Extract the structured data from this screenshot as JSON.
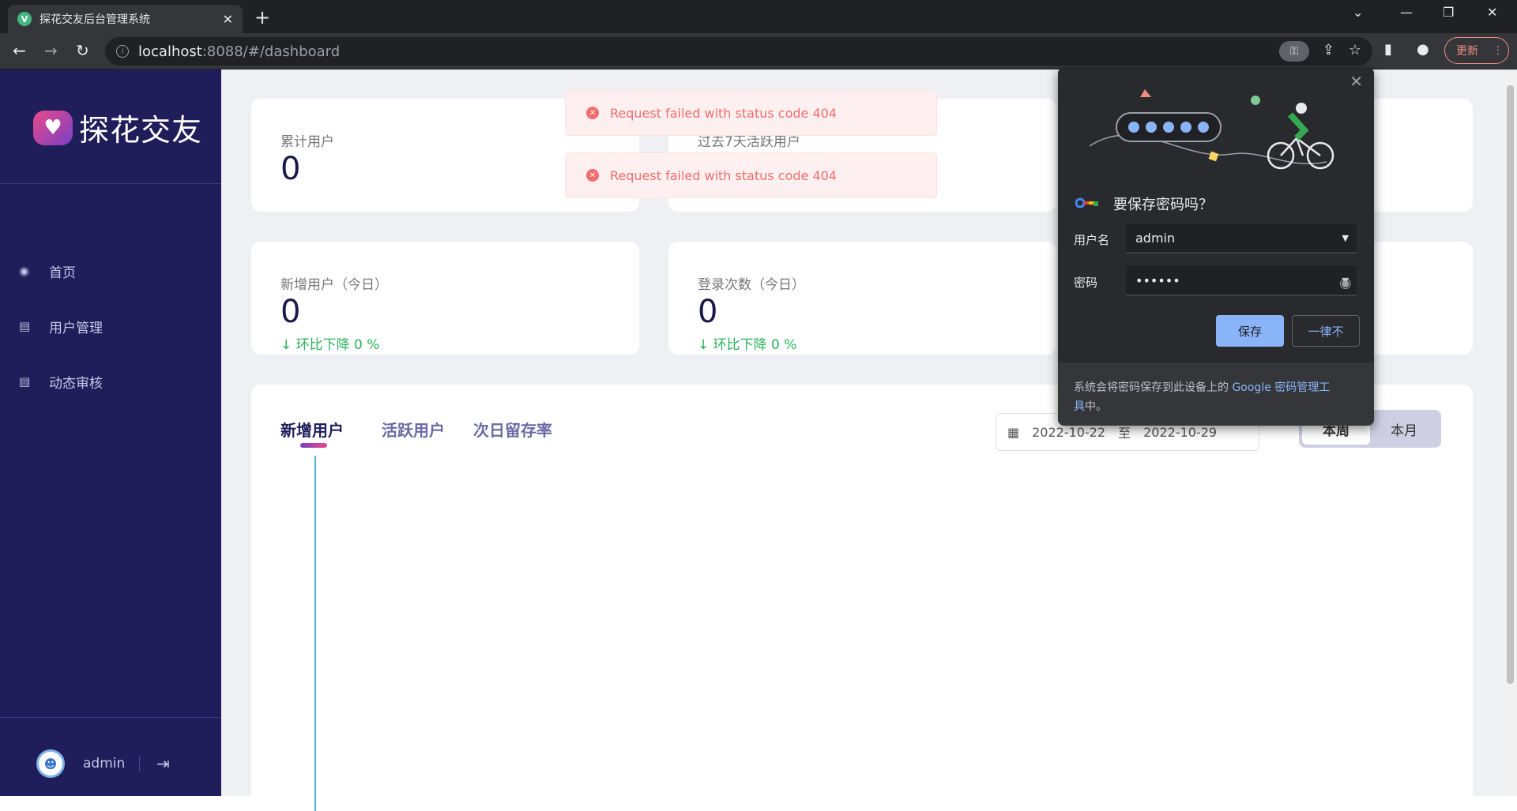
{
  "browser": {
    "tab_title": "探花交友后台管理系统",
    "url_host": "localhost",
    "url_rest": ":8088/#/dashboard",
    "update_label": "更新"
  },
  "sidebar": {
    "logo_text": "探花交友",
    "items": [
      {
        "label": "首页",
        "icon": "dashboard-icon"
      },
      {
        "label": "用户管理",
        "icon": "document-icon"
      },
      {
        "label": "动态审核",
        "icon": "document-icon"
      }
    ],
    "username": "admin"
  },
  "stats": {
    "total_users_label": "累计用户",
    "total_users_value": "0",
    "active_7d_label": "过去7天活跃用户",
    "new_users_label": "新增用户（今日）",
    "new_users_value": "0",
    "new_users_trend": "环比下降 0 %",
    "logins_label": "登录次数（今日）",
    "logins_value": "0",
    "logins_trend": "环比下降 0 %"
  },
  "chart": {
    "tabs": [
      "新增用户",
      "活跃用户",
      "次日留存率"
    ],
    "date_start": "2022-10-22",
    "date_sep": "至",
    "date_end": "2022-10-29",
    "seg_week": "本周",
    "seg_month": "本月"
  },
  "toasts": [
    "Request failed with status code 404",
    "Request failed with status code 404"
  ],
  "password_prompt": {
    "title": "要保存密码吗？",
    "username_label": "用户名",
    "username_value": "admin",
    "password_label": "密码",
    "password_value": "••••••",
    "save_label": "保存",
    "never_label": "一律不",
    "footer_text": "系统会将密码保存到此设备上的 ",
    "footer_link_1": "Google 密码管理工",
    "footer_link_2": "具",
    "footer_end": "中。"
  },
  "colors": {
    "sidebar_bg": "#1f1d5a",
    "trend_green": "#29b25a",
    "error_red": "#f56c6c",
    "accent_blue": "#8ab4f8"
  }
}
